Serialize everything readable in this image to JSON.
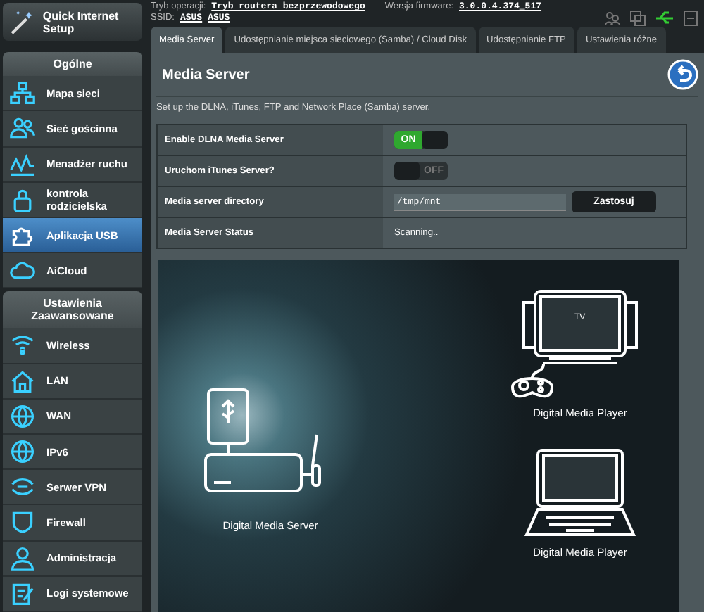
{
  "quick_setup": {
    "label": "Quick Internet Setup"
  },
  "header": {
    "mode_label": "Tryb operacji:",
    "mode_value": "Tryb routera bezprzewodowego",
    "firmware_label": "Wersja firmware:",
    "firmware_value": "3.0.0.4.374_517",
    "ssid_label": "SSID:",
    "ssids": [
      "ASUS",
      "ASUS"
    ]
  },
  "sidebar": {
    "sections": [
      {
        "title": "Ogólne",
        "items": [
          {
            "label": "Mapa sieci",
            "selected": false
          },
          {
            "label": "Sieć gościnna",
            "selected": false
          },
          {
            "label": "Menadżer ruchu",
            "selected": false
          },
          {
            "label": "kontrola rodzicielska",
            "selected": false
          },
          {
            "label": "Aplikacja USB",
            "selected": true
          },
          {
            "label": "AiCloud",
            "selected": false
          }
        ]
      },
      {
        "title": "Ustawienia Zaawansowane",
        "items": [
          {
            "label": "Wireless",
            "selected": false
          },
          {
            "label": "LAN",
            "selected": false
          },
          {
            "label": "WAN",
            "selected": false
          },
          {
            "label": "IPv6",
            "selected": false
          },
          {
            "label": "Serwer VPN",
            "selected": false
          },
          {
            "label": "Firewall",
            "selected": false
          },
          {
            "label": "Administracja",
            "selected": false
          },
          {
            "label": "Logi systemowe",
            "selected": false
          }
        ]
      }
    ]
  },
  "tabs": [
    {
      "label": "Media Server",
      "selected": true
    },
    {
      "label": "Udostępnianie miejsca sieciowego (Samba) / Cloud Disk",
      "selected": false
    },
    {
      "label": "Udostępnianie FTP",
      "selected": false
    },
    {
      "label": "Ustawienia różne",
      "selected": false
    }
  ],
  "panel": {
    "title": "Media Server",
    "description": "Set up the DLNA, iTunes, FTP and Network Place (Samba) server.",
    "rows": [
      {
        "kind": "toggle",
        "label": "Enable DLNA Media Server",
        "on": true,
        "switch_text": "ON"
      },
      {
        "kind": "toggle",
        "label": "Uruchom iTunes Server?",
        "on": false,
        "switch_text": "OFF"
      },
      {
        "kind": "input",
        "label": "Media server directory",
        "value": "/tmp/mnt",
        "button": "Zastosuj"
      },
      {
        "kind": "text",
        "label": "Media Server Status",
        "value": "Scanning.."
      }
    ]
  },
  "illustration": {
    "server_label": "Digital  Media Server",
    "tv_label": "TV",
    "player_labels": [
      "Digital  Media Player",
      "Digital  Media Player"
    ]
  }
}
